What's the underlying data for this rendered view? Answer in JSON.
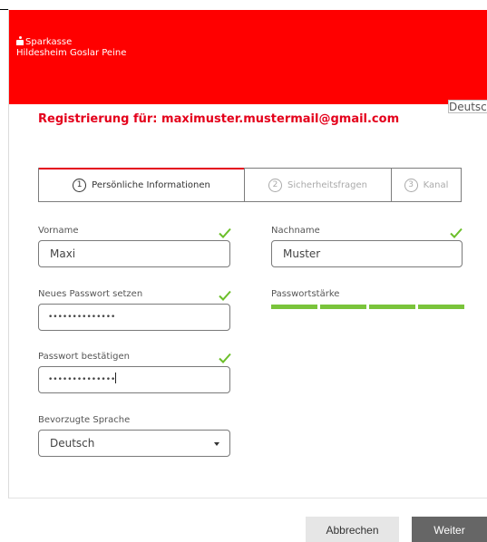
{
  "header": {
    "brand_line1": "Sparkasse",
    "brand_line2": "Hildesheim Goslar Peine",
    "language": "Deutsch"
  },
  "registration": {
    "title": "Registrierung für: maximuster.mustermail@gmail.com"
  },
  "steps": [
    {
      "number": "1",
      "label": "Persönliche Informationen",
      "state": "active"
    },
    {
      "number": "2",
      "label": "Sicherheitsfragen",
      "state": "inactive"
    },
    {
      "number": "3",
      "label": "Kanal",
      "state": "inactive"
    }
  ],
  "form": {
    "firstname_label": "Vorname",
    "firstname_value": "Maxi",
    "lastname_label": "Nachname",
    "lastname_value": "Muster",
    "password_label": "Neues Passwort setzen",
    "password_value": "••••••••••••••",
    "strength_label": "Passwortstärke",
    "strength_level": "4 of 4",
    "confirm_label": "Passwort bestätigen",
    "confirm_value": "••••••••••••••",
    "language_label": "Bevorzugte Sprache",
    "language_value": "Deutsch"
  },
  "buttons": {
    "cancel": "Abbrechen",
    "next": "Weiter"
  },
  "colors": {
    "brand_red": "#ff0000",
    "title_red": "#e4001b",
    "check_green": "#6cbf2a",
    "strength_green": "#7ac43b",
    "next_button": "#666666"
  },
  "icons": {
    "brand": "sparkasse-logo-icon",
    "valid": "checkmark-icon",
    "dropdown": "chevron-down-icon"
  }
}
